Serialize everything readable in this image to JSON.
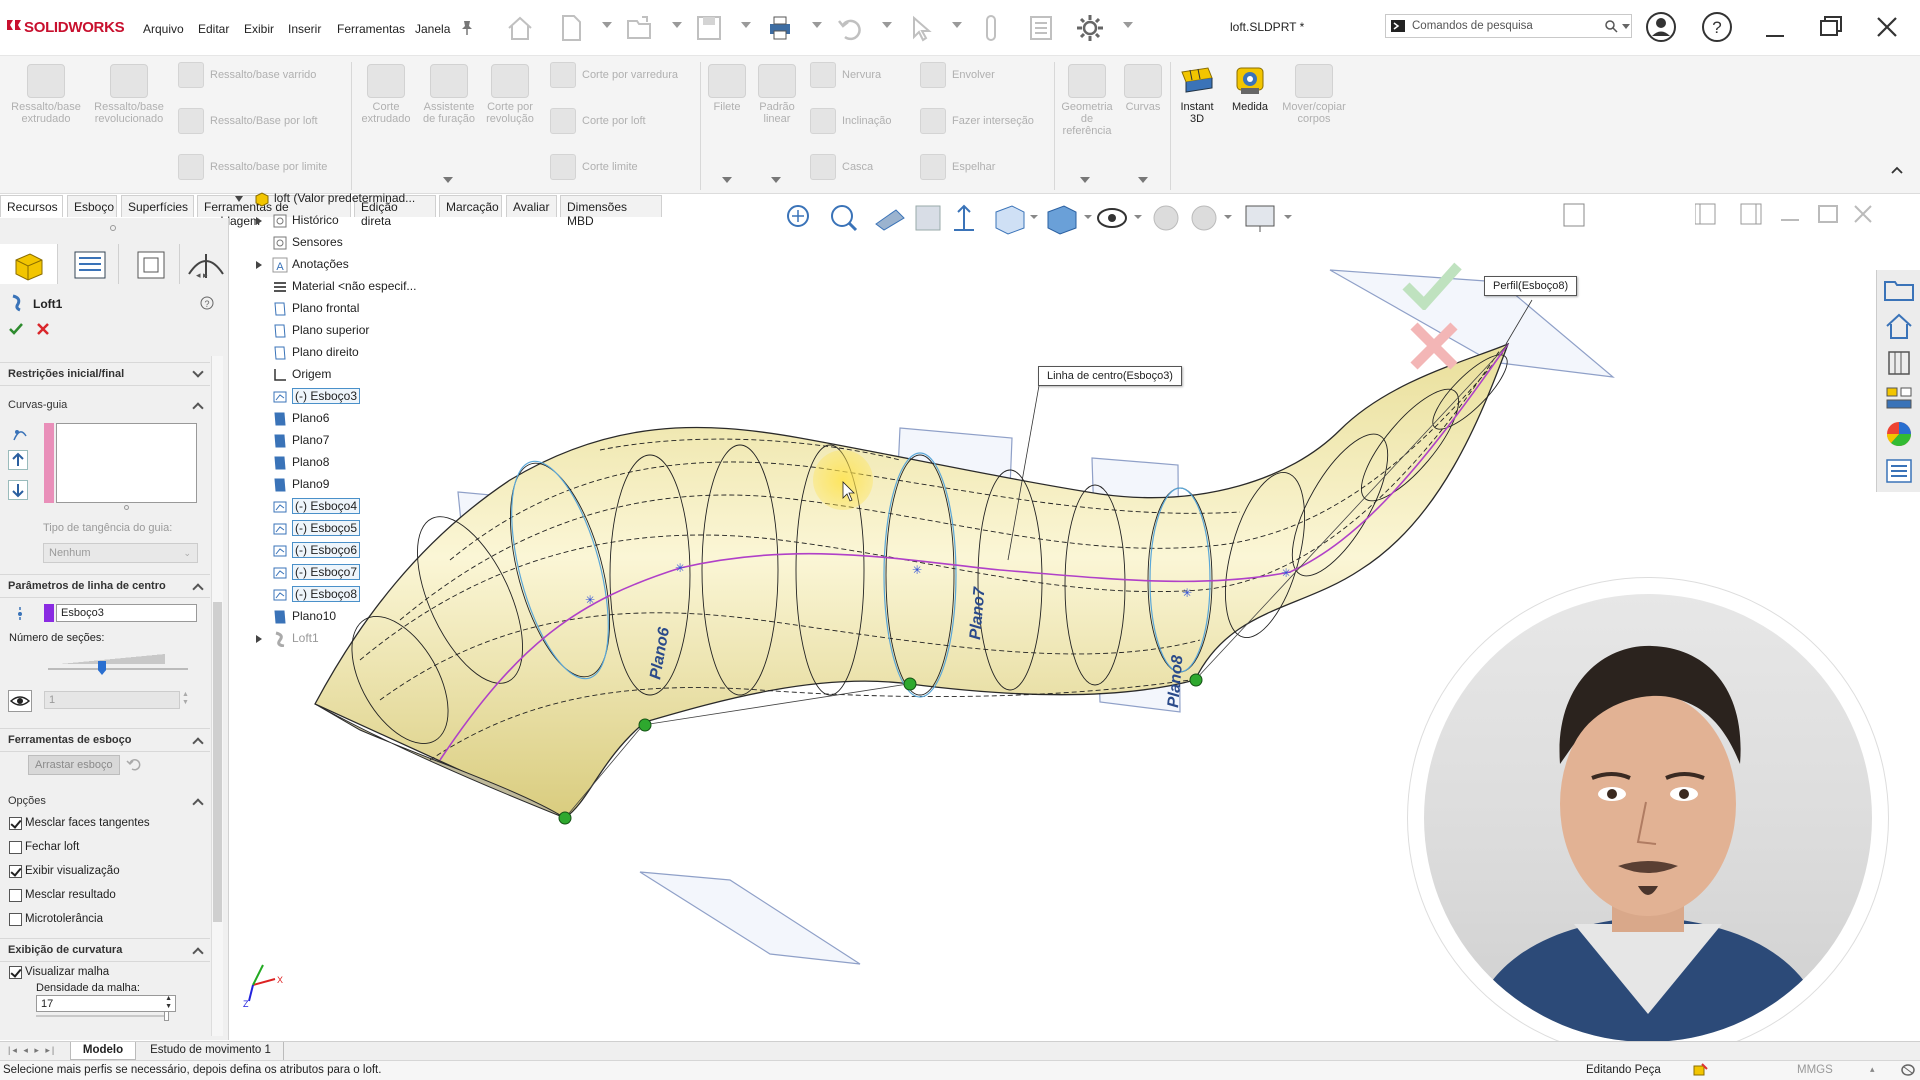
{
  "app": {
    "logo_text": "SOLIDWORKS",
    "document_title": "loft.SLDPRT *"
  },
  "menubar": [
    "Arquivo",
    "Editar",
    "Exibir",
    "Inserir",
    "Ferramentas",
    "Janela"
  ],
  "search": {
    "placeholder": "Comandos de pesquisa"
  },
  "command_manager": {
    "features_large": [
      "Ressalto/base extrudado",
      "Ressalto/base revolucionado"
    ],
    "features_rows": [
      "Ressalto/base varrido",
      "Ressalto/Base por loft",
      "Ressalto/base por limite"
    ],
    "cut_large": [
      "Corte extrudado",
      "Assistente de furação",
      "Corte por revolução"
    ],
    "cut_rows": [
      "Corte por varredura",
      "Corte por loft",
      "Corte limite"
    ],
    "misc_large": [
      "Filete",
      "Padrão linear"
    ],
    "misc_rows_a": [
      "Nervura",
      "Inclinação",
      "Casca"
    ],
    "misc_rows_b": [
      "Envolver",
      "Fazer interseção",
      "Espelhar"
    ],
    "ref_large": [
      "Geometria de referência",
      "Curvas"
    ],
    "tools_large": [
      "Instant 3D",
      "Medida",
      "Mover/copiar corpos"
    ]
  },
  "tabs": [
    "Recursos",
    "Esboço",
    "Superfícies",
    "Ferramentas de moldagem",
    "Edição direta",
    "Marcação",
    "Avaliar",
    "Dimensões MBD"
  ],
  "property_manager": {
    "feature_name": "Loft1",
    "sections": {
      "start_end": "Restrições inicial/final",
      "guide_curves": "Curvas-guia",
      "guide_tangency_label": "Tipo de tangência do guia:",
      "guide_tangency_value": "Nenhum",
      "centerline": "Parâmetros de linha de centro",
      "centerline_value": "Esboço3",
      "sections_count_label": "Número de seções:",
      "sections_count_value": "1",
      "sketch_tools": "Ferramentas de esboço",
      "drag_sketch": "Arrastar esboço",
      "options": "Opções",
      "curvature_display": "Exibição de curvatura",
      "mesh_density_label": "Densidade da malha:",
      "mesh_density_value": "17"
    },
    "options": [
      {
        "label": "Mesclar faces tangentes",
        "checked": true
      },
      {
        "label": "Fechar loft",
        "checked": false
      },
      {
        "label": "Exibir visualização",
        "checked": true
      },
      {
        "label": "Mesclar resultado",
        "checked": false
      },
      {
        "label": "Microtolerância",
        "checked": false
      }
    ],
    "curvature_option": {
      "label": "Visualizar malha",
      "checked": true
    }
  },
  "feature_tree": [
    {
      "label": "loft  (Valor predeterminad...",
      "icon": "part-icon",
      "selected": false
    },
    {
      "label": "Histórico",
      "icon": "history-icon",
      "selected": false
    },
    {
      "label": "Sensores",
      "icon": "sensor-icon",
      "selected": false
    },
    {
      "label": "Anotações",
      "icon": "annotation-icon",
      "selected": false
    },
    {
      "label": "Material <não especif...",
      "icon": "material-icon",
      "selected": false
    },
    {
      "label": "Plano frontal",
      "icon": "plane-icon",
      "selected": false
    },
    {
      "label": "Plano superior",
      "icon": "plane-icon",
      "selected": false
    },
    {
      "label": "Plano direito",
      "icon": "plane-icon",
      "selected": false
    },
    {
      "label": "Origem",
      "icon": "origin-icon",
      "selected": false
    },
    {
      "label": "(-) Esboço3",
      "icon": "sketch-icon",
      "selected": true
    },
    {
      "label": "Plano6",
      "icon": "plane-icon",
      "selected": false
    },
    {
      "label": "Plano7",
      "icon": "plane-icon",
      "selected": false
    },
    {
      "label": "Plano8",
      "icon": "plane-icon",
      "selected": false
    },
    {
      "label": "Plano9",
      "icon": "plane-icon",
      "selected": false
    },
    {
      "label": "(-) Esboço4",
      "icon": "sketch-icon",
      "selected": true
    },
    {
      "label": "(-) Esboço5",
      "icon": "sketch-icon",
      "selected": true
    },
    {
      "label": "(-) Esboço6",
      "icon": "sketch-icon",
      "selected": true
    },
    {
      "label": "(-) Esboço7",
      "icon": "sketch-icon",
      "selected": true
    },
    {
      "label": "(-) Esboço8",
      "icon": "sketch-icon",
      "selected": true
    },
    {
      "label": "Plano10",
      "icon": "plane-icon",
      "selected": false
    },
    {
      "label": "Loft1",
      "icon": "loft-icon",
      "selected": false
    }
  ],
  "viewport": {
    "callout_profile": "Perfil(Esboço8)",
    "callout_centerline": "Linha de centro(Esboço3)",
    "plane_labels": [
      "Plano6",
      "Plano7",
      "Plano8"
    ]
  },
  "bottom_tabs": [
    "Modelo",
    "Estudo de movimento 1"
  ],
  "status": {
    "message": "Selecione mais perfis se necessário, depois defina os atributos para o loft.",
    "mode": "Editando Peça",
    "units": "MMGS"
  },
  "colors": {
    "accent_red": "#c8102e",
    "surface_yellow": "#f2eab0",
    "ok_green": "#2e8b2e",
    "cancel_red": "#d9262b",
    "centerline_purple": "#a040c0"
  }
}
